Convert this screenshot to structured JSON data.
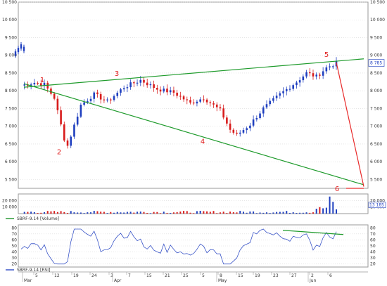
{
  "colors": {
    "up_candle": "#1f3fbf",
    "down_candle": "#d81c1c",
    "trendline": "#1f9b2c",
    "projection": "#e82a2a",
    "volume_bar": "#d81c1c",
    "volume_ma": "#2c9a38",
    "rsi_line": "#3a55c8",
    "grid": "#d8d8d8",
    "axis_text": "#333333"
  },
  "price_panel": {
    "y_ticks_left": [
      "10 500",
      "10 000",
      "9 500",
      "9 000",
      "8 500",
      "8 000",
      "7 500",
      "7 000",
      "6 500",
      "6 000",
      "5 500"
    ],
    "y_ticks_right": [
      "10 500",
      "10 000",
      "9 500",
      "9 000",
      "8 500",
      "8 000",
      "7 500",
      "7 000",
      "6 500",
      "6 000",
      "5 500"
    ],
    "current_value": "8 785",
    "wave_labels": [
      "1",
      "2",
      "3",
      "4",
      "5",
      "6"
    ]
  },
  "volume_panel": {
    "y_ticks_left": [
      "20 000",
      "10 000"
    ],
    "y_ticks_right": [
      "20 000",
      "10 000"
    ],
    "current_value": "13 185",
    "legend": "SBRF-9.14 [Volume]"
  },
  "rsi_panel": {
    "y_ticks_left": [
      "80",
      "70",
      "60",
      "50",
      "40",
      "30",
      "20"
    ],
    "y_ticks_right": [
      "80",
      "70",
      "60",
      "50",
      "40",
      "30",
      "20"
    ],
    "legend": "SBRF-9.14 [RSI]"
  },
  "x_axis": {
    "day_labels": [
      "5",
      "12",
      "19",
      "24",
      "3",
      "7",
      "15",
      "21",
      "25",
      "5",
      "8",
      "15",
      "19",
      "23",
      "27",
      "2",
      "6"
    ],
    "month_labels": [
      "Mar",
      "Apr",
      "May",
      "Jun"
    ]
  },
  "chart_data": [
    {
      "type": "candlestick",
      "title": "",
      "xlabel": "",
      "ylabel": "",
      "ylim": [
        5250,
        10500
      ],
      "series": [
        {
          "name": "SBRF-9.14",
          "values": []
        }
      ],
      "annotations": [
        {
          "label": "1",
          "value": 8200
        },
        {
          "label": "2",
          "value": 6450
        },
        {
          "label": "3",
          "value": 8300
        },
        {
          "label": "4",
          "value": 6750
        },
        {
          "label": "5",
          "value": 8800
        },
        {
          "label": "6",
          "value": 5250
        }
      ],
      "trendlines": [
        {
          "from": 8100,
          "to": 8900,
          "color": "green"
        },
        {
          "from": 8200,
          "to": 5350,
          "color": "green"
        },
        {
          "from": 8800,
          "to": 5250,
          "color": "red",
          "style": "projection"
        }
      ],
      "last_value": 8785,
      "grid": true
    },
    {
      "type": "bar",
      "title": "",
      "ylim": [
        0,
        30000
      ],
      "series": [
        {
          "name": "SBRF-9.14 [Volume]",
          "values": []
        }
      ],
      "last_value": 13185,
      "grid": true
    },
    {
      "type": "line",
      "title": "",
      "ylim": [
        15,
        85
      ],
      "series": [
        {
          "name": "SBRF-9.14 [RSI]",
          "values": []
        }
      ],
      "grid": true
    }
  ]
}
